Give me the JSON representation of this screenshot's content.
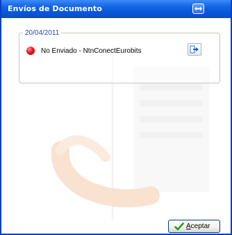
{
  "window": {
    "title": "Envíos de Documento"
  },
  "group": {
    "date": "20/04/2011"
  },
  "document": {
    "status_color": "#e01818",
    "label": "No Enviado - NtnConectEurobits"
  },
  "footer": {
    "accept_mnemonic": "A",
    "accept_rest": "ceptar"
  },
  "colors": {
    "titlebar": "#0a55d9",
    "legend_text": "#1f49c8",
    "watermark": "#f8d8b8"
  },
  "icons": {
    "title_button": "swap-arrows-icon",
    "row_action": "send-arrow-icon",
    "accept": "checkmark-icon"
  }
}
